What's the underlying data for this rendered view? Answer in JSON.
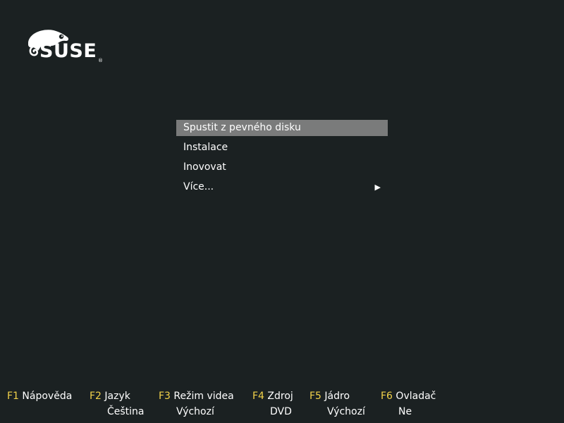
{
  "logo": {
    "text": "SUSE",
    "trademark": "®",
    "icon": "suse-chameleon-logo"
  },
  "menu": {
    "items": [
      {
        "label": "Spustit z pevného disku",
        "selected": true
      },
      {
        "label": "Instalace",
        "selected": false
      },
      {
        "label": "Inovovat",
        "selected": false
      },
      {
        "label": "Více...",
        "selected": false,
        "submenu_arrow": "▶"
      }
    ]
  },
  "function_keys": [
    {
      "key": "F1",
      "label": "Nápověda",
      "value": ""
    },
    {
      "key": "F2",
      "label": "Jazyk",
      "value": "Čeština"
    },
    {
      "key": "F3",
      "label": "Režim videa",
      "value": "Výchozí"
    },
    {
      "key": "F4",
      "label": "Zdroj",
      "value": "DVD"
    },
    {
      "key": "F5",
      "label": "Jádro",
      "value": "Výchozí"
    },
    {
      "key": "F6",
      "label": "Ovladač",
      "value": "Ne"
    }
  ],
  "colors": {
    "background": "#1b2122",
    "selection": "#7a7b7b",
    "fkey_accent": "#f2d249",
    "text": "#ffffff"
  }
}
